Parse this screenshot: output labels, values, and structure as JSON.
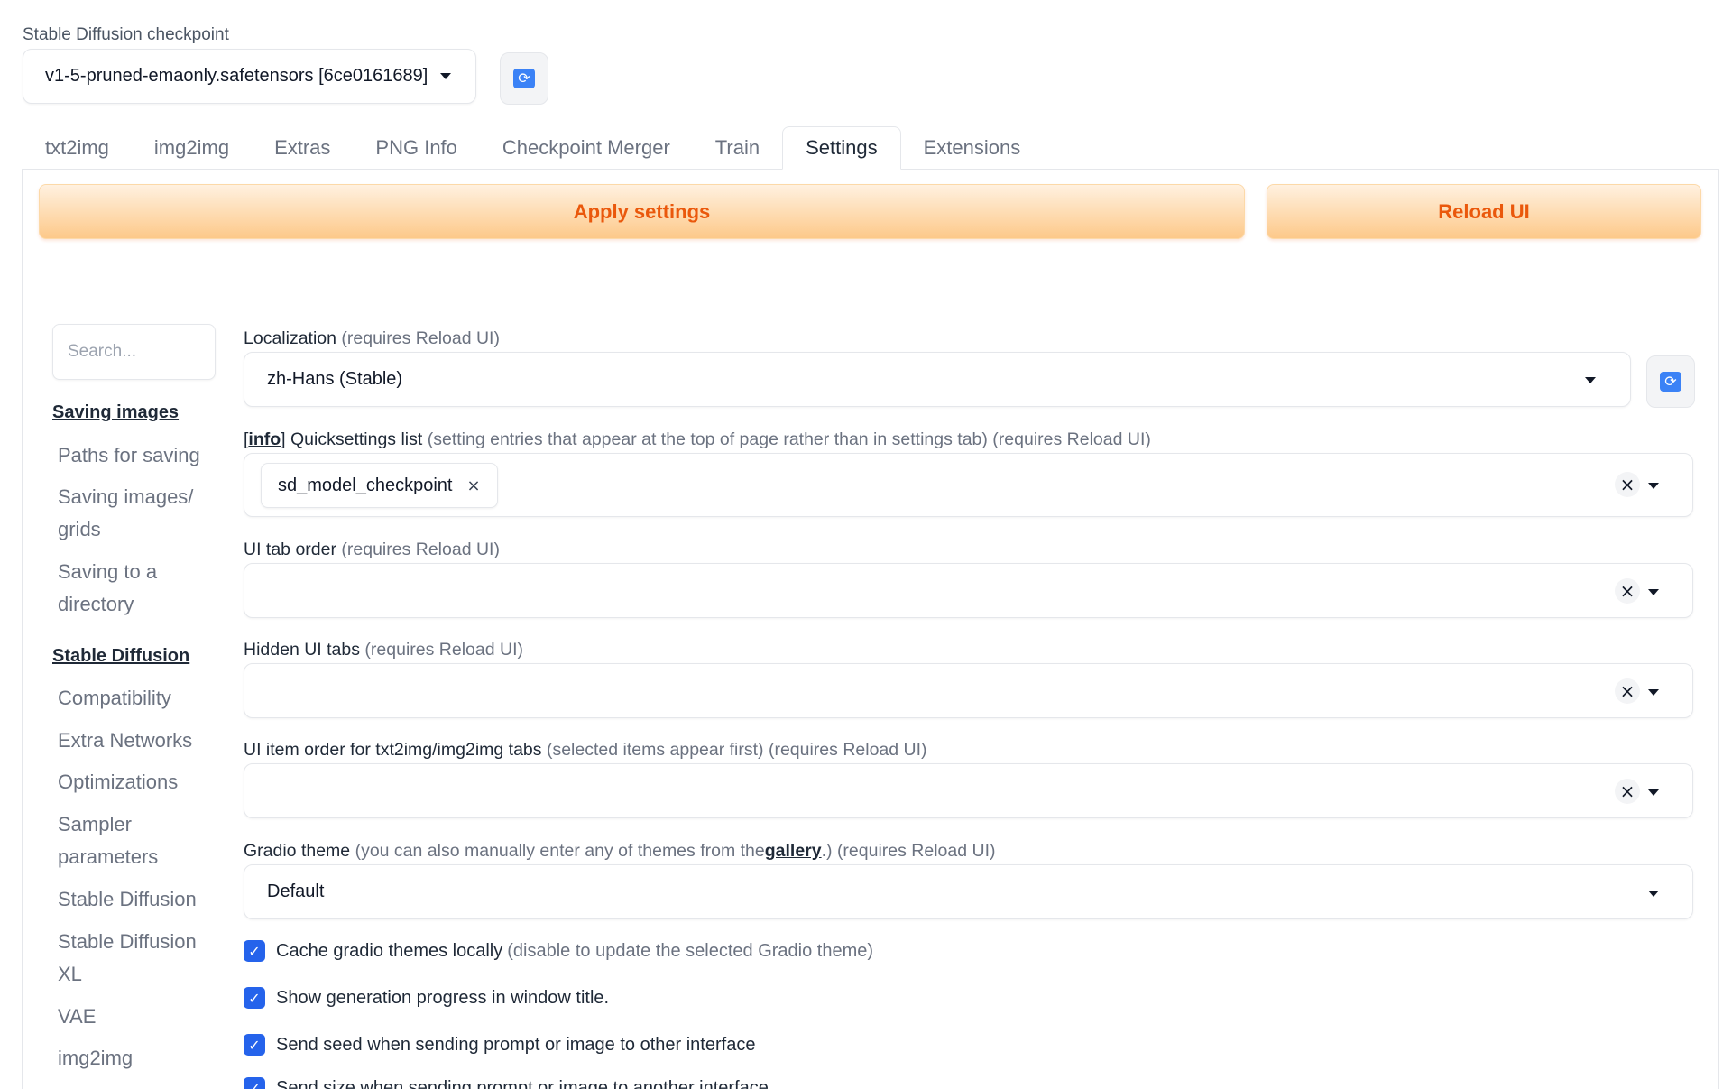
{
  "checkpoint": {
    "label": "Stable Diffusion checkpoint",
    "value": "v1-5-pruned-emaonly.safetensors [6ce0161689]",
    "refresh_icon": "refresh-icon"
  },
  "tabs": [
    "txt2img",
    "img2img",
    "Extras",
    "PNG Info",
    "Checkpoint Merger",
    "Train",
    "Settings",
    "Extensions"
  ],
  "active_tab": "Settings",
  "buttons": {
    "apply": "Apply settings",
    "reload": "Reload UI"
  },
  "colors": {
    "accent": "#ea580c",
    "checkbox": "#2563eb"
  },
  "sidebar": {
    "search_placeholder": "Search...",
    "categories": [
      {
        "title": "Saving images",
        "items": [
          "Paths for saving",
          "Saving images/",
          "grids",
          "Saving to a",
          "directory"
        ]
      },
      {
        "title": "Stable Diffusion",
        "items": [
          "Compatibility",
          "Extra Networks",
          "Optimizations",
          "Sampler",
          "parameters",
          "Stable Diffusion",
          "Stable Diffusion",
          "XL",
          "VAE",
          "img2img"
        ]
      }
    ]
  },
  "settings": {
    "localization": {
      "label": "Localization",
      "hint": "(requires Reload UI)",
      "value": "zh-Hans (Stable)"
    },
    "quicksettings": {
      "info": "info",
      "label": "Quicksettings list",
      "hint": "(setting entries that appear at the top of page rather than in settings tab) (requires Reload UI)",
      "chip": "sd_model_checkpoint"
    },
    "tab_order": {
      "label": "UI tab order",
      "hint": "(requires Reload UI)"
    },
    "hidden_tabs": {
      "label": "Hidden UI tabs",
      "hint": "(requires Reload UI)"
    },
    "item_order": {
      "label": "UI item order for txt2img/img2img tabs",
      "hint": "(selected items appear first) (requires Reload UI)"
    },
    "gradio_theme": {
      "label": "Gradio theme",
      "hint_pre": "(you can also manually enter any of themes from the",
      "link": "gallery",
      "hint_post": ".) (requires Reload UI)",
      "value": "Default"
    },
    "checkboxes": [
      {
        "label": "Cache gradio themes locally",
        "hint": "(disable to update the selected Gradio theme)",
        "checked": true
      },
      {
        "label": "Show generation progress in window title.",
        "hint": "",
        "checked": true
      },
      {
        "label": "Send seed when sending prompt or image to other interface",
        "hint": "",
        "checked": true
      },
      {
        "label": "Send size when sending prompt or image to another interface",
        "hint": "",
        "checked": true
      }
    ]
  }
}
